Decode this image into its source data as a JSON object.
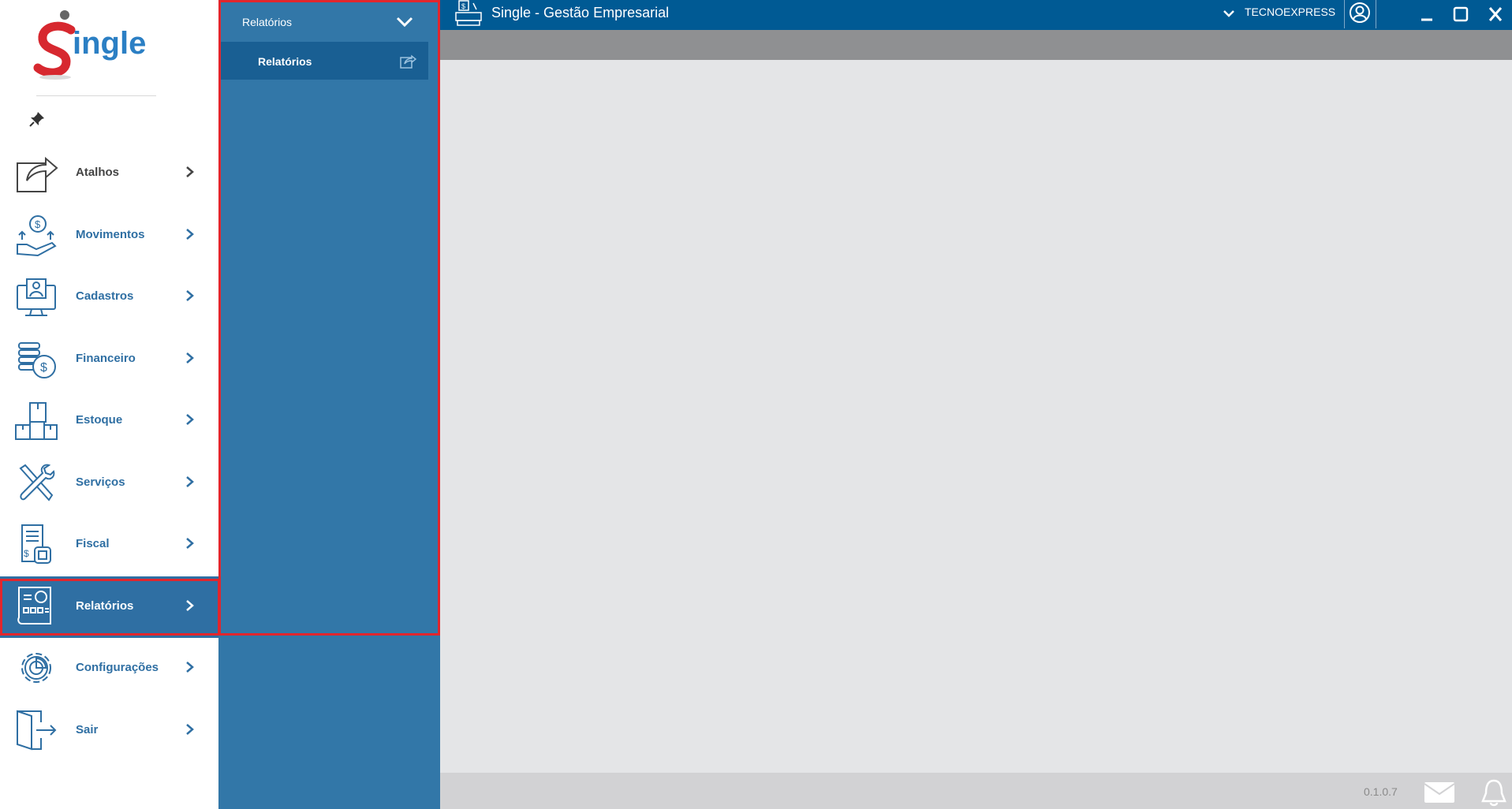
{
  "titlebar": {
    "app_title": "Single - Gestão Empresarial",
    "company": "TECNOEXPRESS"
  },
  "logo": {
    "text": "Single"
  },
  "sidebar": {
    "items": [
      {
        "label": "Atalhos",
        "icon": "share-box-icon"
      },
      {
        "label": "Movimentos",
        "icon": "money-hand-icon"
      },
      {
        "label": "Cadastros",
        "icon": "monitor-user-icon"
      },
      {
        "label": "Financeiro",
        "icon": "coins-icon"
      },
      {
        "label": "Estoque",
        "icon": "boxes-icon"
      },
      {
        "label": "Serviços",
        "icon": "tools-icon"
      },
      {
        "label": "Fiscal",
        "icon": "receipt-icon"
      },
      {
        "label": "Relatórios",
        "icon": "report-icon",
        "active": true
      },
      {
        "label": "Configurações",
        "icon": "gear-icon"
      },
      {
        "label": "Sair",
        "icon": "exit-door-icon"
      }
    ]
  },
  "submenu": {
    "title": "Relatórios",
    "items": [
      {
        "label": "Relatórios"
      }
    ]
  },
  "status": {
    "version": "0.1.0.7"
  },
  "colors": {
    "primary": "#005a94",
    "panel": "#3277a8",
    "highlight": "#e1262d"
  }
}
